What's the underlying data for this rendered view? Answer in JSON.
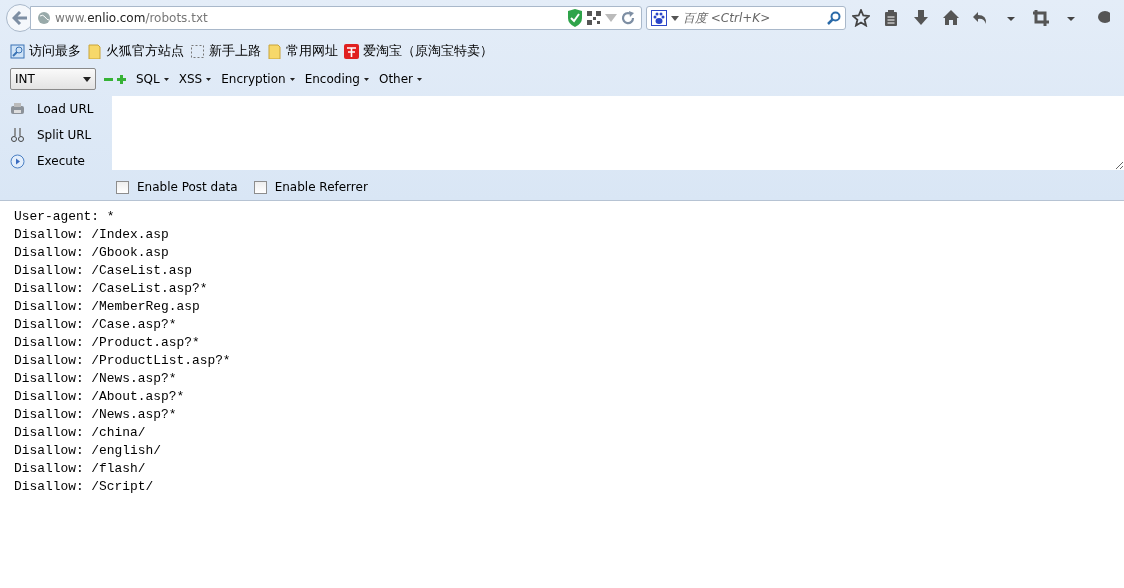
{
  "address_bar": {
    "url_prefix": "www.",
    "url_host": "enlio.com",
    "url_path": "/robots.txt"
  },
  "search_box": {
    "placeholder": "百度 <Ctrl+K>"
  },
  "bookmarks": [
    {
      "label": "访问最多",
      "kind": "smart"
    },
    {
      "label": "火狐官方站点",
      "kind": "folder"
    },
    {
      "label": "新手上路",
      "kind": "empty"
    },
    {
      "label": "常用网址",
      "kind": "folder"
    },
    {
      "label": "爱淘宝（原淘宝特卖）",
      "kind": "taobao"
    }
  ],
  "hackbar": {
    "type_select": "INT",
    "menus": [
      "SQL",
      "XSS",
      "Encryption",
      "Encoding",
      "Other"
    ],
    "actions": [
      {
        "label": "Load URL",
        "kind": "load"
      },
      {
        "label": "Split URL",
        "kind": "split"
      },
      {
        "label": "Execute",
        "kind": "execute"
      }
    ],
    "options": [
      {
        "label": "Enable Post data",
        "checked": false
      },
      {
        "label": "Enable Referrer",
        "checked": false
      }
    ]
  },
  "content_lines": [
    "User-agent: *",
    "Disallow: /Index.asp",
    "Disallow: /Gbook.asp",
    "Disallow: /CaseList.asp",
    "Disallow: /CaseList.asp?*",
    "Disallow: /MemberReg.asp",
    "Disallow: /Case.asp?*",
    "Disallow: /Product.asp?*",
    "Disallow: /ProductList.asp?*",
    "Disallow: /News.asp?*",
    "Disallow: /About.asp?*",
    "Disallow: /News.asp?*",
    "Disallow: /china/",
    "Disallow: /english/",
    "Disallow: /flash/",
    "Disallow: /Script/"
  ]
}
